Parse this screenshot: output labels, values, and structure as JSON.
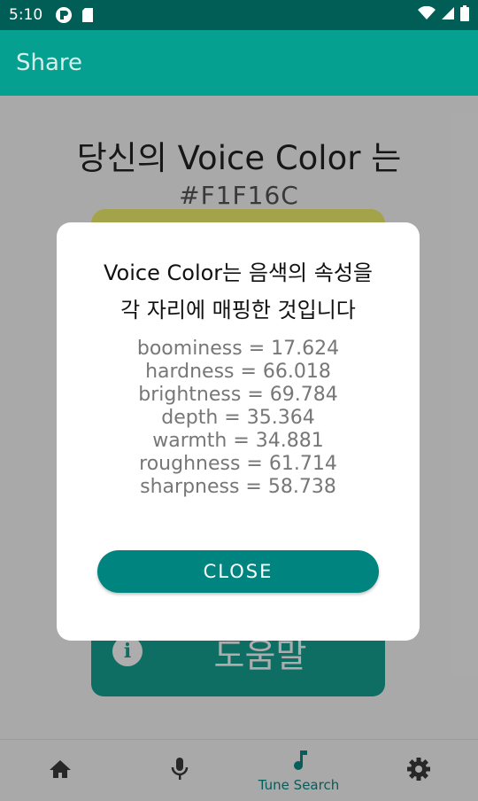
{
  "status_bar": {
    "time": "5:10",
    "icons": [
      "notification-app-icon",
      "sd-card-icon",
      "wifi-icon",
      "signal-icon",
      "battery-icon"
    ]
  },
  "app_bar": {
    "title": "Share"
  },
  "main": {
    "heading": "당신의 Voice Color 는",
    "hex_value": "#F1F16C",
    "swatch_color": "#F1F16C",
    "help_button": {
      "icon": "info-icon",
      "label": "도움말"
    }
  },
  "dialog": {
    "title_line1": "Voice Color는 음색의 속성을",
    "title_line2": "각 자리에 매핑한 것입니다",
    "attributes": [
      "boominess = 17.624",
      "hardness = 66.018",
      "brightness = 69.784",
      "depth = 35.364",
      "warmth = 34.881",
      "roughness = 61.714",
      "sharpness = 58.738"
    ],
    "close_label": "CLOSE"
  },
  "bottom_nav": {
    "items": [
      {
        "icon": "home-icon",
        "label": ""
      },
      {
        "icon": "microphone-icon",
        "label": ""
      },
      {
        "icon": "music-note-icon",
        "label": "Tune Search"
      },
      {
        "icon": "gear-icon",
        "label": ""
      }
    ]
  },
  "colors": {
    "primary": "#06A091",
    "primary_dark": "#015E56",
    "accent": "#00847F"
  }
}
